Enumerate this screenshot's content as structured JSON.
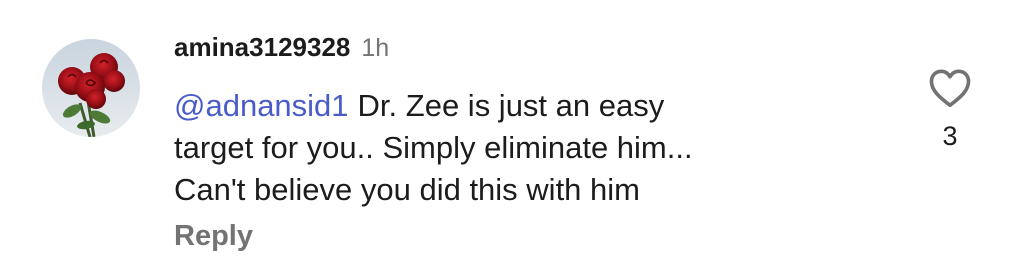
{
  "comment": {
    "username": "amina3129328",
    "time": "1h",
    "mention": "@adnansid1",
    "lines": [
      "Dr. Zee is just an easy",
      "target for you.. Simply eliminate him...",
      "Can't believe you did this with him"
    ],
    "reply_label": "Reply",
    "like_count": "3"
  },
  "icons": {
    "avatar": "roses-avatar-image",
    "like": "heart-outline-icon"
  },
  "colors": {
    "text": "#1c1c1c",
    "muted": "#737373",
    "mention": "#4a5cc9"
  }
}
